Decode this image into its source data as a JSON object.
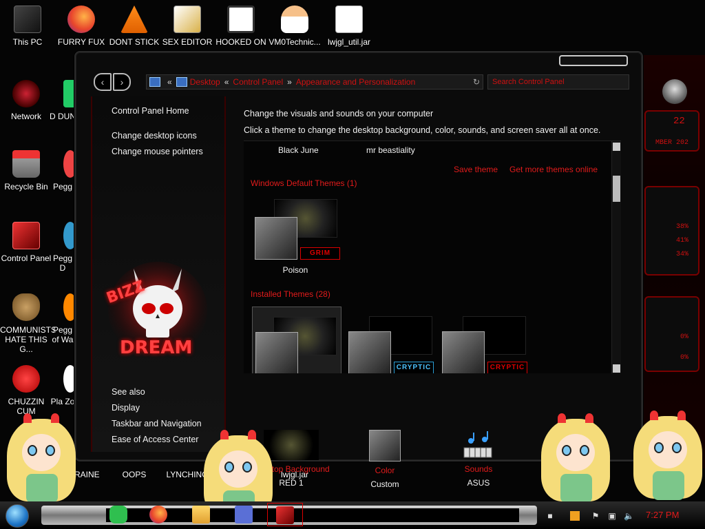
{
  "desktop": {
    "icons_top": [
      {
        "label": "This PC"
      },
      {
        "label": "FURRY FUX"
      },
      {
        "label": "DONT STICK"
      },
      {
        "label": "SEX EDITOR"
      },
      {
        "label": "HOOKED ON"
      },
      {
        "label": "VM0Technic..."
      },
      {
        "label": "lwjgl_util.jar"
      }
    ],
    "icons_left": [
      {
        "label": "Network"
      },
      {
        "label": "Recycle Bin"
      },
      {
        "label": "Control Panel"
      },
      {
        "label": "COMMUNISTS HATE THIS G..."
      },
      {
        "label": "CHUZZIN CUM"
      }
    ],
    "icons_left_partial": [
      {
        "label": "D DUN"
      },
      {
        "label": "Pegg"
      },
      {
        "label": "Pegg D"
      },
      {
        "label": "Pegg of Wa"
      },
      {
        "label": "Pla Zo"
      }
    ],
    "icons_bottom": [
      {
        "label": "UKRAINE"
      },
      {
        "label": "OOPS"
      },
      {
        "label": "LYNCHING"
      },
      {
        "label": "lwjgl.jar"
      }
    ]
  },
  "window": {
    "address": {
      "segments": [
        "Desktop",
        "Control Panel",
        "Appearance and Personalization"
      ],
      "separators": [
        "«",
        "»"
      ]
    },
    "search_placeholder": "Search Control Panel",
    "left_pane": {
      "home": "Control Panel Home",
      "links": [
        "Change desktop icons",
        "Change mouse pointers"
      ],
      "skull_text_top": "BIZZ",
      "skull_text_bottom": "DREAM",
      "see_also_title": "See also",
      "see_also": [
        "Display",
        "Taskbar and Navigation",
        "Ease of Access Center"
      ]
    },
    "content": {
      "heading": "Change the visuals and sounds on your computer",
      "subheading": "Click a theme to change the desktop background, color, sounds, and screen saver all at once.",
      "my_themes": [
        "Black June",
        "mr beastiality"
      ],
      "save_theme": "Save theme",
      "get_more": "Get more themes online",
      "default_header": "Windows Default Themes (1)",
      "default_themes": [
        {
          "name": "Poison",
          "tag": "GRIM"
        }
      ],
      "installed_header": "Installed Themes (28)",
      "installed_themes": [
        {
          "tag": "",
          "selected": true
        },
        {
          "tag": "CRYPTIC",
          "tag_color": "blue"
        },
        {
          "tag": "CRYPTIC",
          "tag_color": "red"
        }
      ]
    },
    "bottom": [
      {
        "label": "Desktop Background",
        "value": "RED 1"
      },
      {
        "label": "Color",
        "value": "Custom"
      },
      {
        "label": "Sounds",
        "value": "ASUS"
      },
      {
        "label": "",
        "value": ""
      }
    ]
  },
  "wallpaper": {
    "readouts": [
      "22",
      "MBER 202",
      "38%",
      "41%",
      "34%",
      "0%",
      "0%"
    ]
  },
  "taskbar": {
    "clock": "7:27 PM"
  },
  "colors": {
    "accent_red": "#e21b1b",
    "text": "#f2f2f2",
    "background": "#050505"
  }
}
